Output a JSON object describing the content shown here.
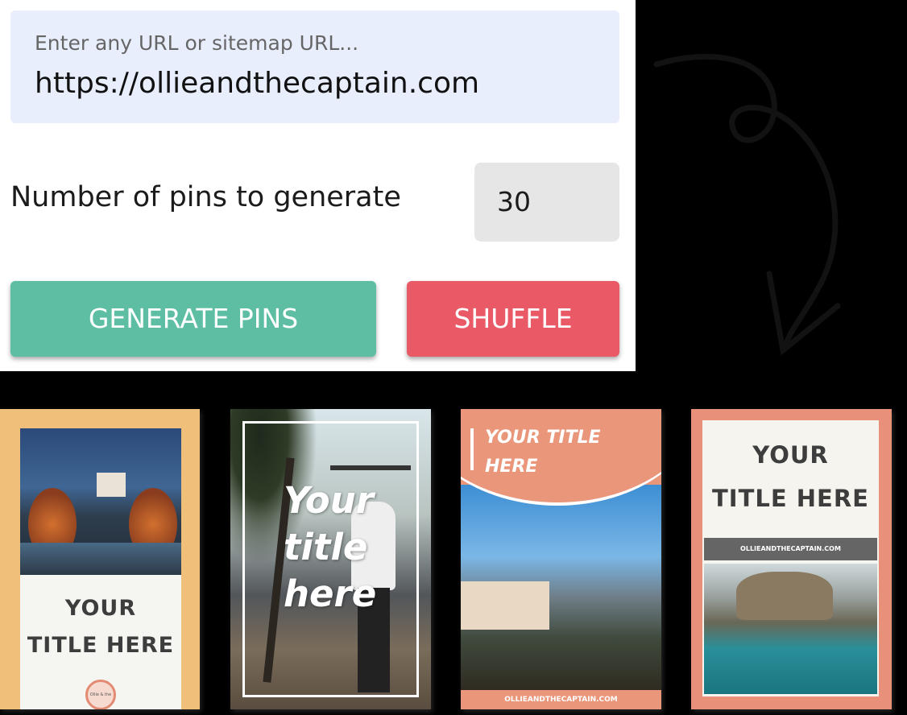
{
  "form": {
    "url_placeholder": "Enter any URL or sitemap URL...",
    "url_value": "https://ollieandthecaptain.com",
    "pins_label": "Number of pins to generate",
    "pins_count": "30",
    "generate_label": "GENERATE PINS",
    "shuffle_label": "SHUFFLE"
  },
  "colors": {
    "input_bg": "#e8eefc",
    "generate": "#5dbea3",
    "shuffle": "#e95a66",
    "card1": "#f0c07a",
    "card3": "#ea967b",
    "card4": "#e8907a"
  },
  "pins": [
    {
      "title_line1": "YOUR",
      "title_line2": "TITLE HERE",
      "logo_text": "Ollie & the Captain"
    },
    {
      "title_line1": "Your",
      "title_line2": "title",
      "title_line3": "here"
    },
    {
      "title_line1": "YOUR TITLE",
      "title_line2": "HERE",
      "domain": "OLLIEANDTHECAPTAIN.COM"
    },
    {
      "title_line1": "YOUR",
      "title_line2": "TITLE HERE",
      "domain": "OLLIEANDTHECAPTAIN.COM"
    }
  ]
}
